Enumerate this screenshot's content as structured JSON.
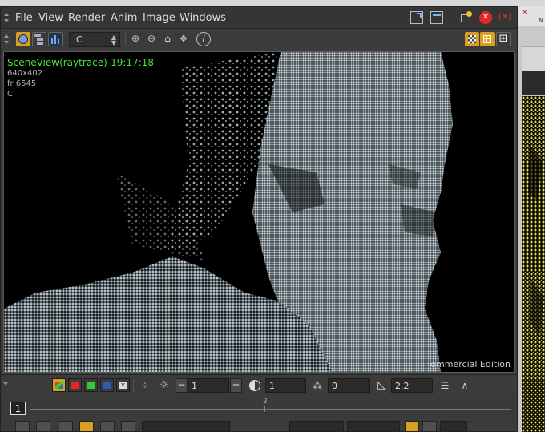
{
  "menu": {
    "file": "File",
    "view": "View",
    "render": "Render",
    "anim": "Anim",
    "image": "Image",
    "windows": "Windows"
  },
  "toolbar": {
    "channel_select": "C"
  },
  "viewport": {
    "title": "SceneView(raytrace)-19:17:18",
    "resolution": "640x402",
    "frame": "fr 6545",
    "channel": "C",
    "edition": "ommercial Edition"
  },
  "bottombar": {
    "exposure_value": "1",
    "contrast_value": "1",
    "offset_value": "0",
    "gamma_value": "2.2",
    "minus": "−",
    "plus": "+"
  },
  "timeline": {
    "current_frame": "1",
    "tick_label": "2"
  },
  "right_panel": {
    "tab_label": "N"
  },
  "colors": {
    "accent": "#d9a020",
    "viewport_text": "#48e038",
    "background": "#3b3b3b"
  }
}
